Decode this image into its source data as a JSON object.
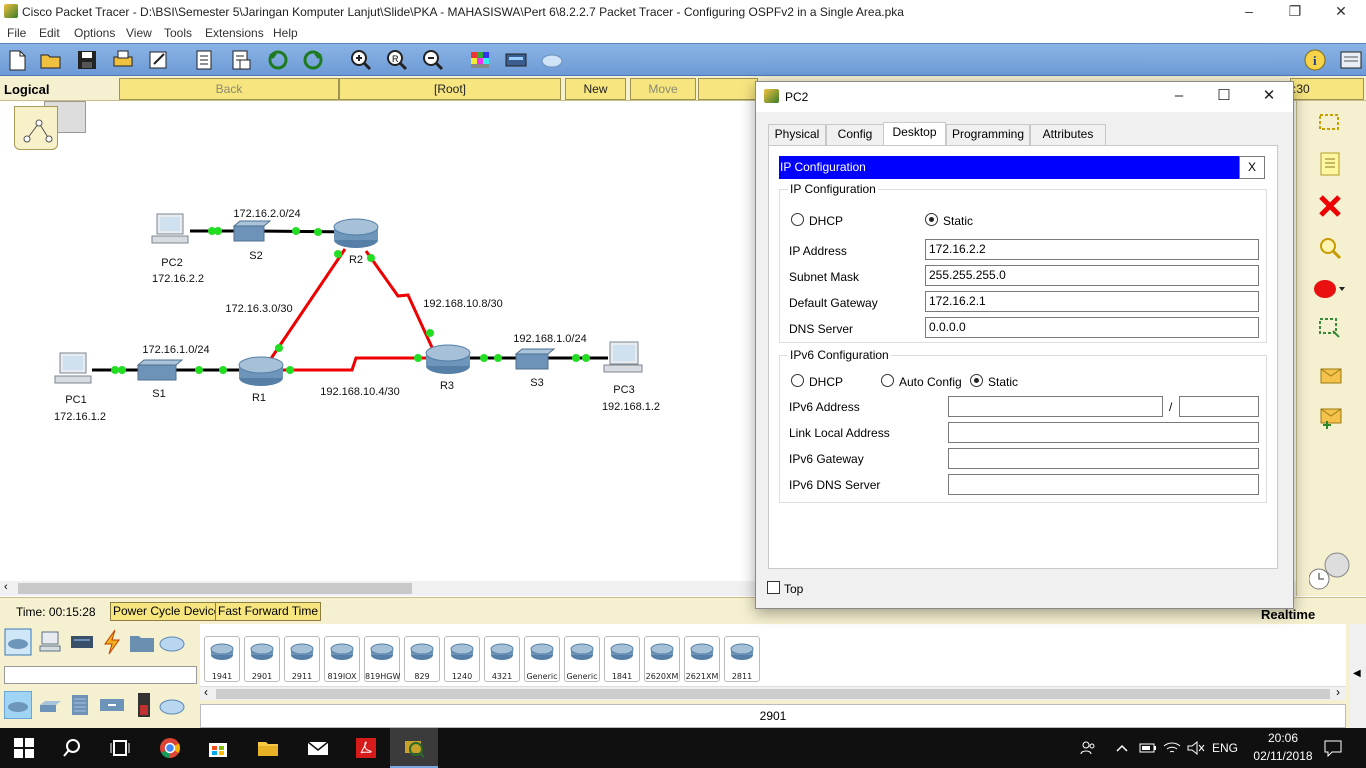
{
  "app": {
    "title": "Cisco Packet Tracer - D:\\BSI\\Semester 5\\Jaringan Komputer Lanjut\\Slide\\PKA - MAHASISWA\\Pert 6\\8.2.2.7 Packet Tracer - Configuring OSPFv2 in a Single Area.pka"
  },
  "menu": [
    "File",
    "Edit",
    "Options",
    "View",
    "Tools",
    "Extensions",
    "Help"
  ],
  "logical_bar": {
    "mode": "Logical",
    "back": "Back",
    "root": "[Root]",
    "new_cluster": "New Cluster",
    "move_object": "Move Object",
    "clock_fragment": ":30"
  },
  "topology": {
    "devices": {
      "pc2": {
        "name": "PC2",
        "ip": "172.16.2.2"
      },
      "s2": {
        "name": "S2"
      },
      "r2": {
        "name": "R2"
      },
      "pc1": {
        "name": "PC1",
        "ip": "172.16.1.2"
      },
      "s1": {
        "name": "S1"
      },
      "r1": {
        "name": "R1"
      },
      "r3": {
        "name": "R3"
      },
      "s3": {
        "name": "S3"
      },
      "pc3": {
        "name": "PC3",
        "ip": "192.168.1.2"
      }
    },
    "networks": {
      "n1": "172.16.2.0/24",
      "n2": "172.16.3.0/30",
      "n3": "192.168.10.8/30",
      "n4": "172.16.1.0/24",
      "n5": "192.168.1.0/24",
      "n6": "192.168.10.4/30"
    }
  },
  "status": {
    "time": "Time: 00:15:28",
    "power_cycle": "Power Cycle Devices",
    "fast_forward": "Fast Forward Time",
    "realtime": "Realtime"
  },
  "devices_panel": {
    "routers": [
      "1941",
      "2901",
      "2911",
      "819IOX",
      "819HGW",
      "829",
      "1240",
      "4321",
      "Generic",
      "Generic",
      "1841",
      "2620XM",
      "2621XM",
      "2811"
    ],
    "selected_model": "2901"
  },
  "dialog": {
    "title": "PC2",
    "tabs": [
      "Physical",
      "Config",
      "Desktop",
      "Programming",
      "Attributes"
    ],
    "active_tab": "Desktop",
    "header": "IP Configuration",
    "close_x": "X",
    "ipv4": {
      "group": "IP Configuration",
      "dhcp": "DHCP",
      "static": "Static",
      "mode": "Static",
      "ip_label": "IP Address",
      "ip": "172.16.2.2",
      "mask_label": "Subnet Mask",
      "mask": "255.255.255.0",
      "gw_label": "Default Gateway",
      "gw": "172.16.2.1",
      "dns_label": "DNS Server",
      "dns": "0.0.0.0"
    },
    "ipv6": {
      "group": "IPv6 Configuration",
      "dhcp": "DHCP",
      "auto": "Auto Config",
      "static": "Static",
      "mode": "Static",
      "addr_label": "IPv6 Address",
      "slash": "/",
      "addr": "",
      "prefix": "",
      "link_label": "Link Local Address",
      "link": "",
      "gw_label": "IPv6 Gateway",
      "gw": "",
      "dns_label": "IPv6 DNS Server",
      "dns": ""
    },
    "top_label": "Top"
  },
  "taskbar": {
    "lang": "ENG",
    "time": "20:06",
    "date": "02/11/2018"
  }
}
